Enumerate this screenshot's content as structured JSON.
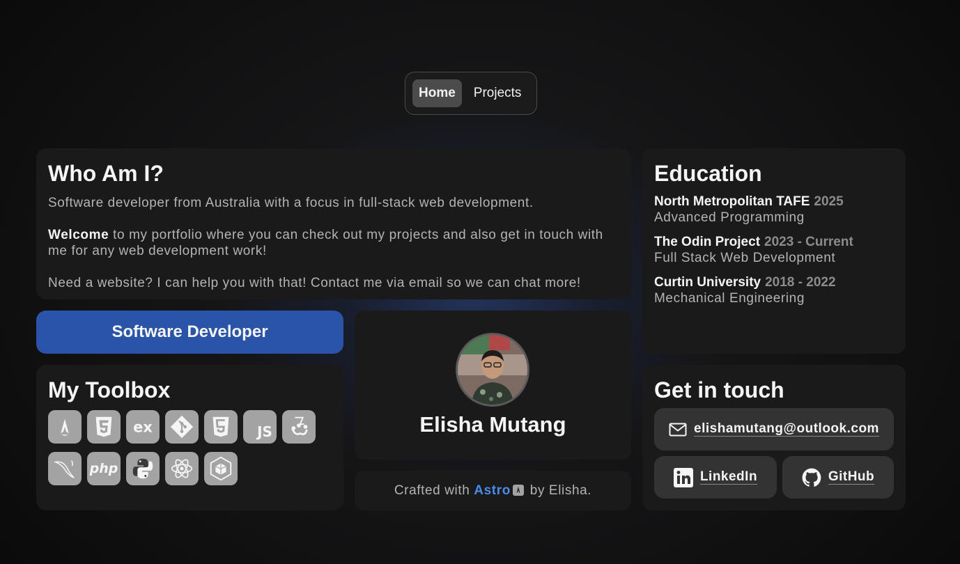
{
  "nav": {
    "items": [
      {
        "label": "Home",
        "active": true
      },
      {
        "label": "Projects",
        "active": false
      }
    ]
  },
  "about": {
    "title": "Who Am I?",
    "intro": "Software developer from Australia with a focus in full-stack web development.",
    "welcome_bold": "Welcome",
    "welcome_rest": " to my portfolio where you can check out my projects and also get in touch with me for any web development work!",
    "cta": "Need a website? I can help you with that! Contact me via email so we can chat more!"
  },
  "education": {
    "title": "Education",
    "items": [
      {
        "name": "North Metropolitan TAFE",
        "date": "2025",
        "course": "Advanced Programming"
      },
      {
        "name": "The Odin Project",
        "date": "2023 - Current",
        "course": "Full Stack Web Development"
      },
      {
        "name": "Curtin University",
        "date": "2018 - 2022",
        "course": "Mechanical Engineering"
      }
    ]
  },
  "role": {
    "label": "Software Developer"
  },
  "profile": {
    "name": "Elisha Mutang"
  },
  "toolbox": {
    "title": "My Toolbox",
    "tools": [
      "astro-icon",
      "css3-icon",
      "elixir-icon",
      "git-icon",
      "html5-icon",
      "javascript-icon",
      "jest-icon",
      "mysql-icon",
      "php-icon",
      "python-icon",
      "react-icon",
      "webpack-icon"
    ],
    "php_text": "php",
    "js_text": "JS"
  },
  "footer": {
    "prefix": "Crafted with ",
    "astro": "Astro",
    "suffix": " by Elisha."
  },
  "contact": {
    "title": "Get in touch",
    "email": "elishamutang@outlook.com",
    "linkedin": "LinkedIn",
    "github": "GitHub"
  },
  "colors": {
    "accent": "#2a54a8",
    "link": "#4a8be8",
    "card": "#1a1a1a",
    "icon_bg": "#a3a3a3"
  }
}
